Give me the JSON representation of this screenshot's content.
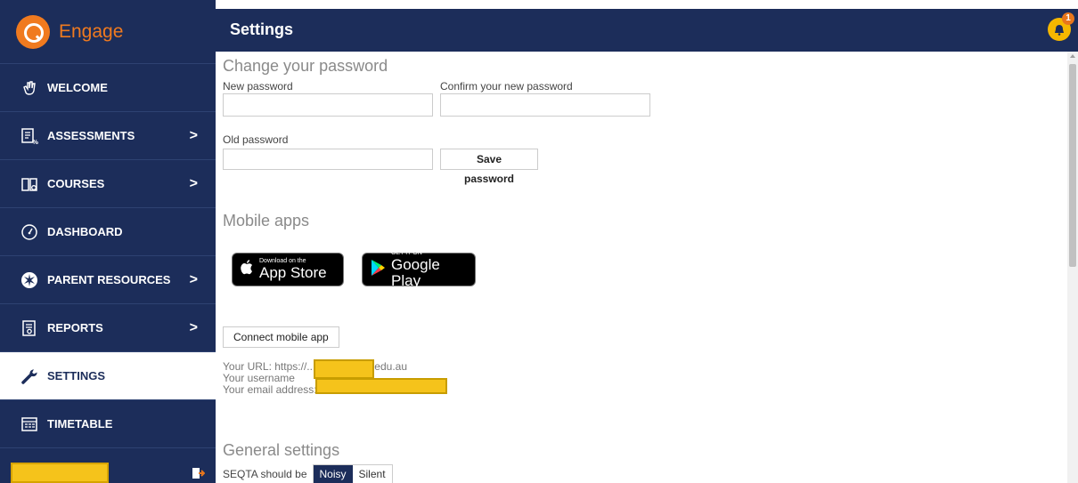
{
  "app": {
    "brand": "Engage"
  },
  "header": {
    "title": "Settings",
    "notification_count": "1"
  },
  "sidebar": {
    "items": [
      {
        "label": "WELCOME"
      },
      {
        "label": "ASSESSMENTS",
        "chevron": ">"
      },
      {
        "label": "COURSES",
        "chevron": ">"
      },
      {
        "label": "DASHBOARD"
      },
      {
        "label": "PARENT RESOURCES",
        "chevron": ">"
      },
      {
        "label": "REPORTS",
        "chevron": ">"
      },
      {
        "label": "SETTINGS",
        "active": true
      },
      {
        "label": "TIMETABLE"
      }
    ]
  },
  "password": {
    "title": "Change your password",
    "new_label": "New password",
    "confirm_label": "Confirm your new password",
    "old_label": "Old password",
    "save_label": "Save password"
  },
  "mobile": {
    "title": "Mobile apps",
    "appstore_small": "Download on the",
    "appstore_big": "App Store",
    "googleplay_small": "GET IT ON",
    "googleplay_big": "Google Play",
    "connect_label": "Connect mobile app",
    "url_line": "Your URL: https://.................tas.edu.au",
    "username_line": "Your username",
    "email_line": "Your email address: ..................tas.edu.au"
  },
  "general": {
    "title": "General settings",
    "noise_label": "SEQTA should be",
    "noisy": "Noisy",
    "silent": "Silent"
  },
  "colors": {
    "navy": "#1c2d5a",
    "orange": "#f07a1f",
    "highlight": "#f5c31b"
  }
}
